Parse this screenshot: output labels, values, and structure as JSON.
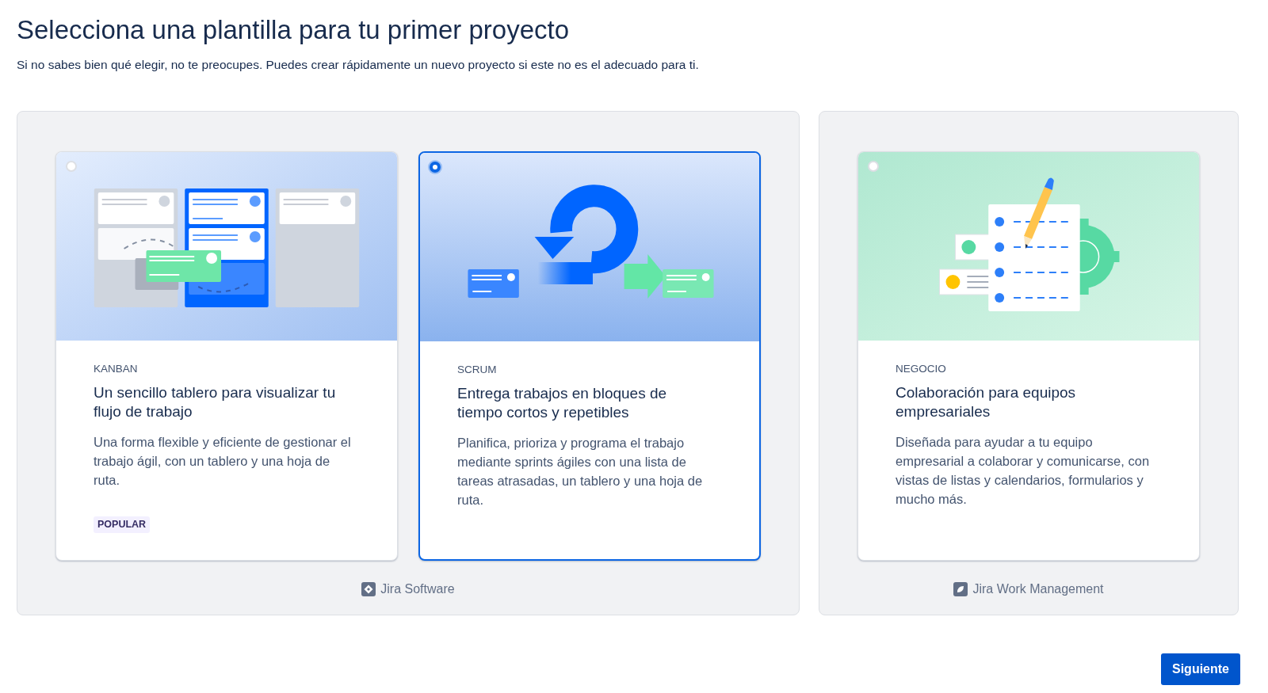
{
  "title": "Selecciona una plantilla para tu primer proyecto",
  "subtitle": "Si no sabes bien qué elegir, no te preocupes. Puedes crear rápidamente un nuevo proyecto si este no es el adecuado para ti.",
  "groups": [
    {
      "product": "Jira Software",
      "kind": "diamond",
      "templates": [
        {
          "kind": "kanban",
          "selected": false,
          "category": "KANBAN",
          "heading": "Un sencillo tablero para visualizar tu flujo de trabajo",
          "description": "Una forma flexible y eficiente de gestionar el trabajo ágil, con un tablero y una hoja de ruta.",
          "badge": "POPULAR"
        },
        {
          "kind": "scrum",
          "selected": true,
          "category": "SCRUM",
          "heading": "Entrega trabajos en bloques de tiempo cortos y repetibles",
          "description": "Planifica, prioriza y programa el trabajo mediante sprints ágiles con una lista de tareas atrasadas, un tablero y una hoja de ruta."
        }
      ]
    },
    {
      "product": "Jira Work Management",
      "kind": "leaf",
      "templates": [
        {
          "kind": "business",
          "selected": false,
          "category": "NEGOCIO",
          "heading": "Colaboración para equipos empresariales",
          "description": "Diseñada para ayudar a tu equipo empresarial a colaborar y comunicarse, con vistas de listas y calendarios, formularios y mucho más."
        }
      ]
    }
  ],
  "next_button": "Siguiente"
}
